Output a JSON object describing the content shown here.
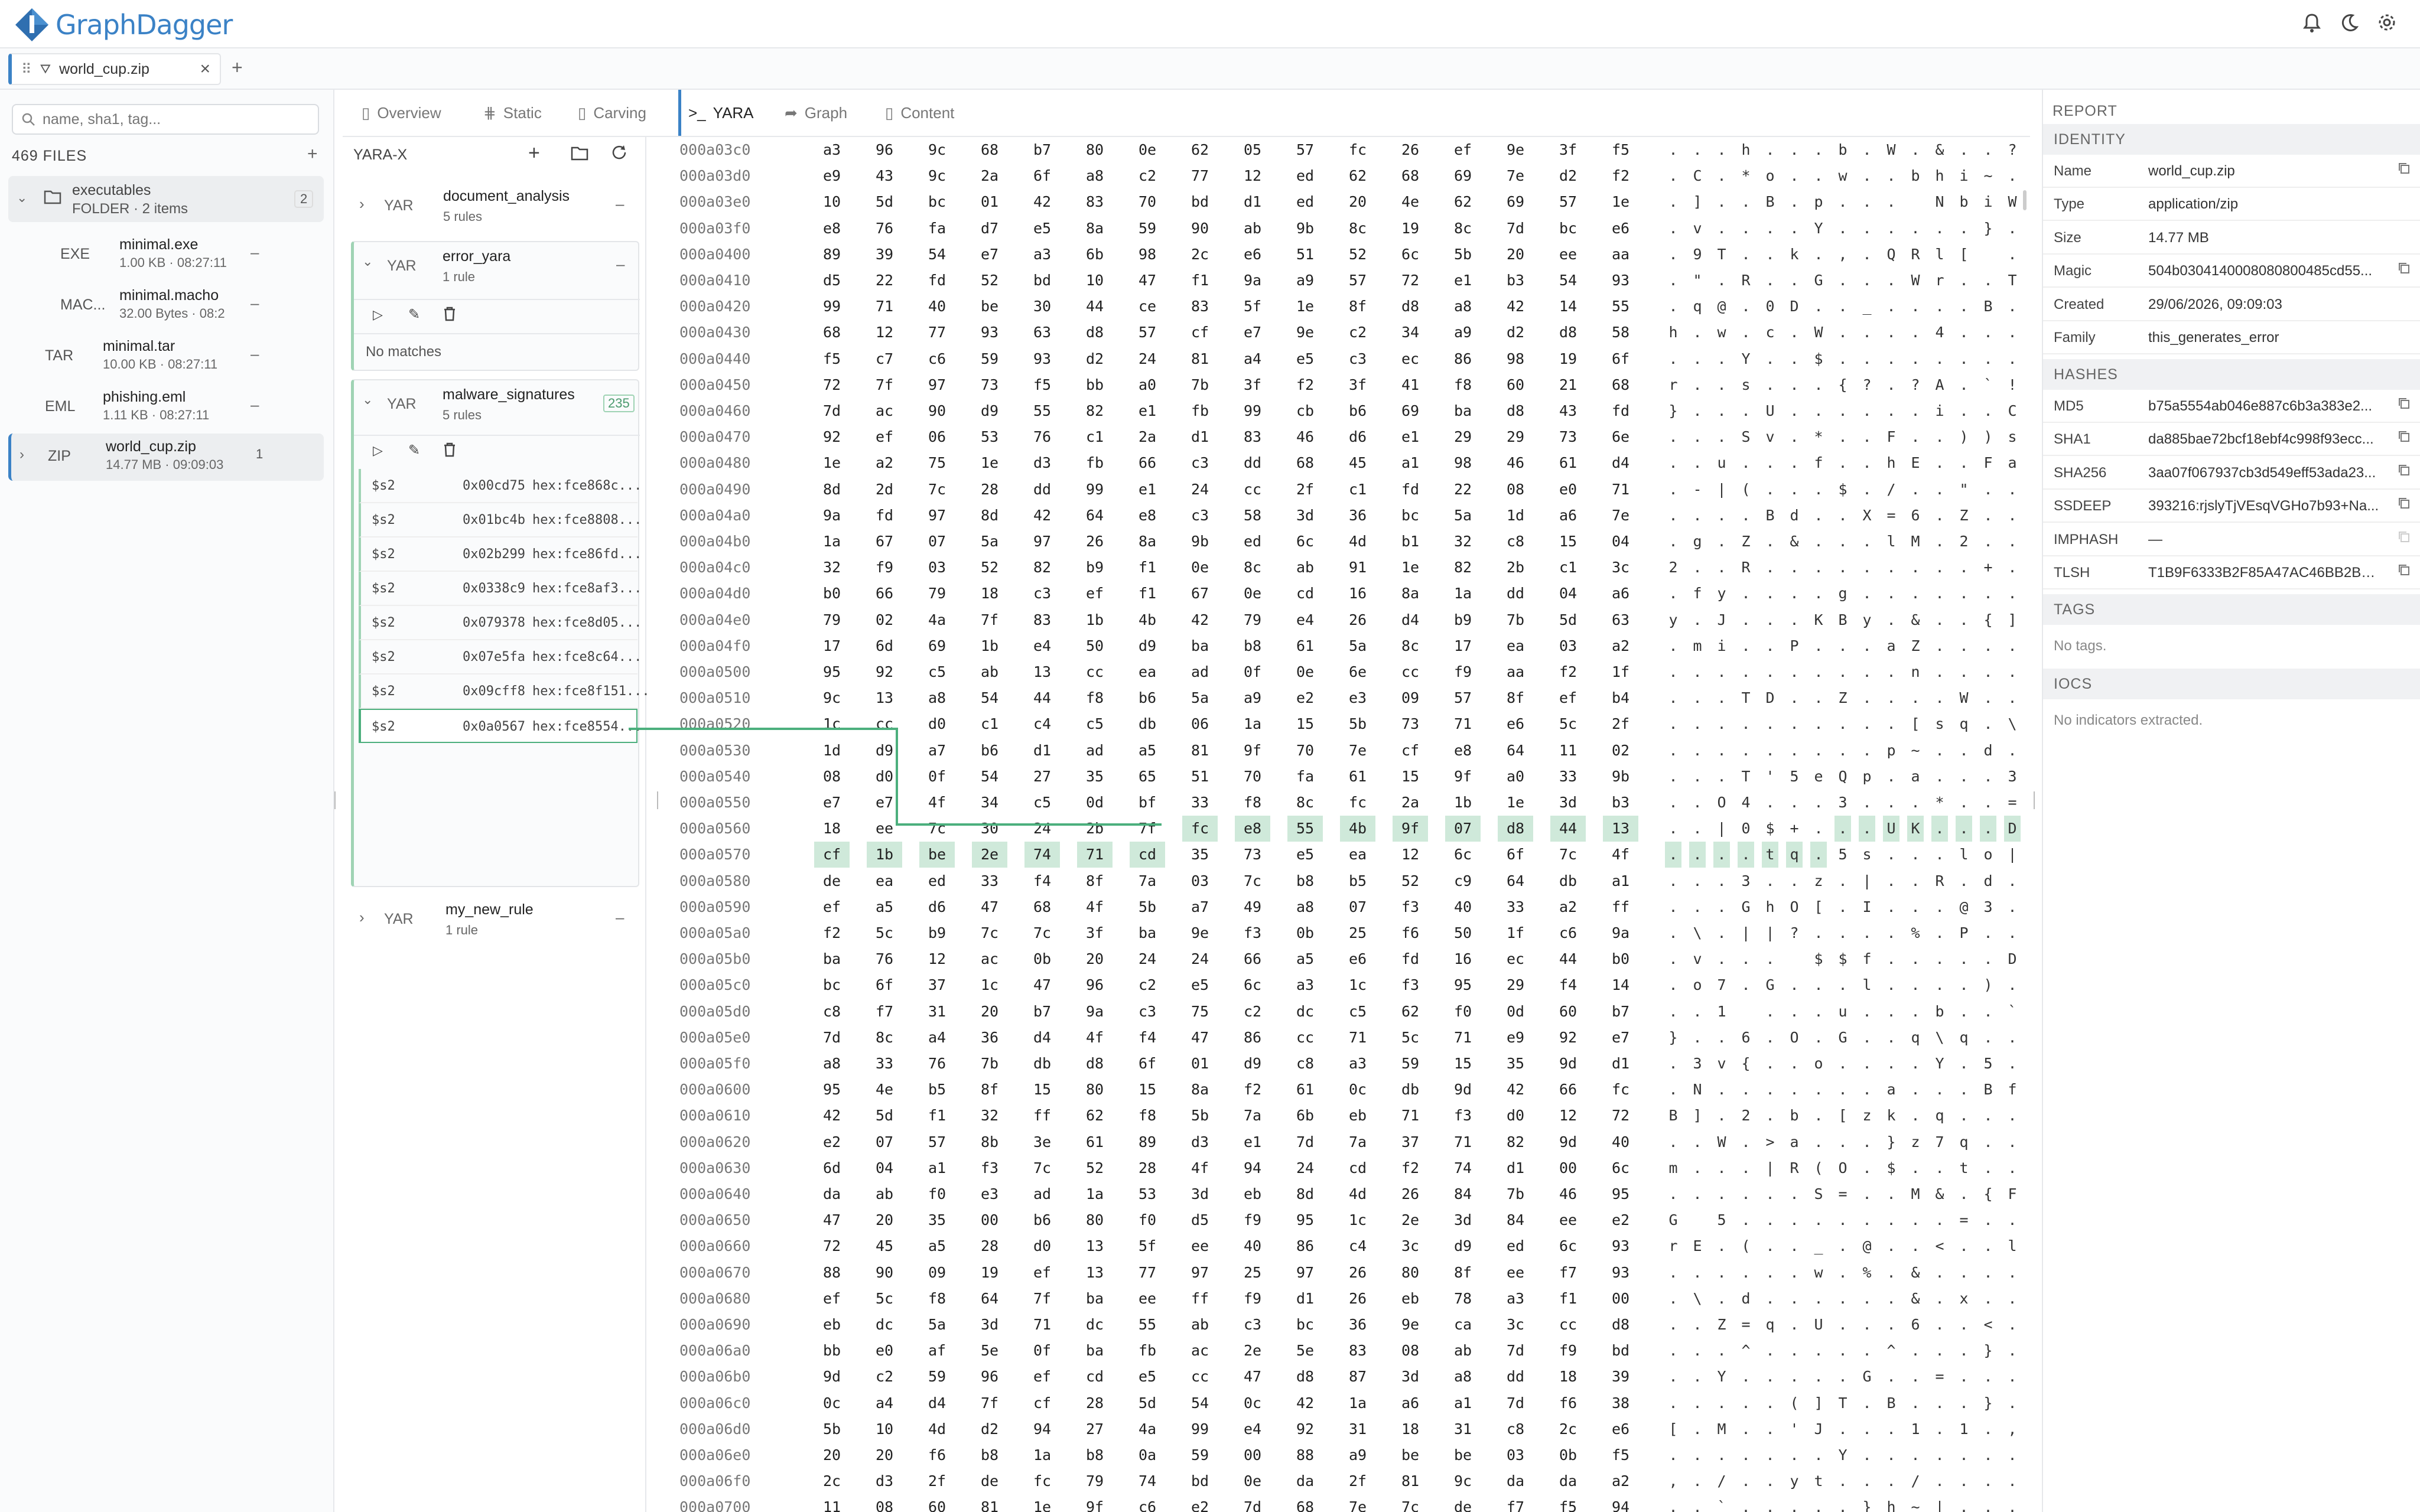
{
  "app": {
    "title": "GraphDagger"
  },
  "tab": {
    "label": "world_cup.zip",
    "close": "×",
    "add": "+"
  },
  "sidebar": {
    "search_placeholder": "name, sha1, tag...",
    "files_count": "469 FILES",
    "add": "+",
    "items": [
      {
        "type": "FOLDER",
        "name": "executables",
        "meta": "FOLDER · 2 items",
        "badge": "2"
      },
      {
        "type": "EXE",
        "name": "minimal.exe",
        "meta": "1.00 KB · 08:27:11"
      },
      {
        "type": "MAC...",
        "name": "minimal.macho",
        "meta": "32.00 Bytes · 08:2"
      },
      {
        "type": "TAR",
        "name": "minimal.tar",
        "meta": "10.00 KB · 08:27:11"
      },
      {
        "type": "EML",
        "name": "phishing.eml",
        "meta": "1.11 KB · 08:27:11"
      },
      {
        "type": "ZIP",
        "name": "world_cup.zip",
        "meta": "14.77 MB · 09:09:03",
        "badge": "1"
      }
    ]
  },
  "main_tabs": [
    "Overview",
    "Static",
    "Carving",
    "YARA",
    "Graph",
    "Content"
  ],
  "yara": {
    "title": "YARA-X",
    "rules": [
      {
        "tag": "YAR",
        "name": "document_analysis",
        "count": "5 rules"
      },
      {
        "tag": "YAR",
        "name": "error_yara",
        "count": "1 rule",
        "no_matches": "No matches"
      },
      {
        "tag": "YAR",
        "name": "malware_signatures",
        "count": "5 rules",
        "badge": "235"
      },
      {
        "tag": "YAR",
        "name": "my_new_rule",
        "count": "1 rule"
      }
    ],
    "matches": [
      {
        "id": "$s2",
        "offset": "0x00cd75",
        "hex": "hex:fce868c..."
      },
      {
        "id": "$s2",
        "offset": "0x01bc4b",
        "hex": "hex:fce8808..."
      },
      {
        "id": "$s2",
        "offset": "0x02b299",
        "hex": "hex:fce86fd..."
      },
      {
        "id": "$s2",
        "offset": "0x0338c9",
        "hex": "hex:fce8af3..."
      },
      {
        "id": "$s2",
        "offset": "0x079378",
        "hex": "hex:fce8d05..."
      },
      {
        "id": "$s2",
        "offset": "0x07e5fa",
        "hex": "hex:fce8c64..."
      },
      {
        "id": "$s2",
        "offset": "0x09cff8",
        "hex": "hex:fce8f151..."
      },
      {
        "id": "$s2",
        "offset": "0x0a0567",
        "hex": "hex:fce8554..."
      }
    ]
  },
  "hex": {
    "rows": [
      [
        "000a03c0",
        "a3 96 9c 68 b7 80 0e 62 05 57 fc 26 ef 9e 3f f5",
        ". . . h . . . b . W . & . . ? ."
      ],
      [
        "000a03d0",
        "e9 43 9c 2a 6f a8 c2 77 12 ed 62 68 69 7e d2 f2",
        ". C . * o . . w . . b h i ~ . ."
      ],
      [
        "000a03e0",
        "10 5d bc 01 42 83 70 bd d1 ed 20 4e 62 69 57 1e",
        ". ] . . B . p . . .   N b i W ."
      ],
      [
        "000a03f0",
        "e8 76 fa d7 e5 8a 59 90 ab 9b 8c 19 8c 7d bc e6",
        ". v . . . . Y . . . . . . } . ."
      ],
      [
        "000a0400",
        "89 39 54 e7 a3 6b 98 2c e6 51 52 6c 5b 20 ee aa",
        ". 9 T . . k . , . Q R l [   . ."
      ],
      [
        "000a0410",
        "d5 22 fd 52 bd 10 47 f1 9a a9 57 72 e1 b3 54 93",
        ". \" . R . . G . . . W r . . T ."
      ],
      [
        "000a0420",
        "99 71 40 be 30 44 ce 83 5f 1e 8f d8 a8 42 14 55",
        ". q @ . 0 D . . _ . . . . B . U"
      ],
      [
        "000a0430",
        "68 12 77 93 63 d8 57 cf e7 9e c2 34 a9 d2 d8 58",
        "h . w . c . W . . . . 4 . . . X"
      ],
      [
        "000a0440",
        "f5 c7 c6 59 93 d2 24 81 a4 e5 c3 ec 86 98 19 6f",
        ". . . Y . . $ . . . . . . . . o"
      ],
      [
        "000a0450",
        "72 7f 97 73 f5 bb a0 7b 3f f2 3f 41 f8 60 21 68",
        "r . . s . . . { ? . ? A . ` ! h"
      ],
      [
        "000a0460",
        "7d ac 90 d9 55 82 e1 fb 99 cb b6 69 ba d8 43 fd",
        "} . . . U . . . . . . i . . C ."
      ],
      [
        "000a0470",
        "92 ef 06 53 76 c1 2a d1 83 46 d6 e1 29 29 73 6e",
        ". . . S v . * . . F . . ) ) s n"
      ],
      [
        "000a0480",
        "1e a2 75 1e d3 fb 66 c3 dd 68 45 a1 98 46 61 d4",
        ". . u . . . f . . h E . . F a ."
      ],
      [
        "000a0490",
        "8d 2d 7c 28 dd 99 e1 24 cc 2f c1 fd 22 08 e0 71",
        ". - | ( . . . $ . / . . \" . . q"
      ],
      [
        "000a04a0",
        "9a fd 97 8d 42 64 e8 c3 58 3d 36 bc 5a 1d a6 7e",
        ". . . . B d . . X = 6 . Z . . ~"
      ],
      [
        "000a04b0",
        "1a 67 07 5a 97 26 8a 9b ed 6c 4d b1 32 c8 15 04",
        ". g . Z . & . . . l M . 2 . . ."
      ],
      [
        "000a04c0",
        "32 f9 03 52 82 b9 f1 0e 8c ab 91 1e 82 2b c1 3c",
        "2 . . R . . . . . . . . . + . <"
      ],
      [
        "000a04d0",
        "b0 66 79 18 c3 ef f1 67 0e cd 16 8a 1a dd 04 a6",
        ". f y . . . . g . . . . . . . ."
      ],
      [
        "000a04e0",
        "79 02 4a 7f 83 1b 4b 42 79 e4 26 d4 b9 7b 5d 63",
        "y . J . . . K B y . & . . { ] c"
      ],
      [
        "000a04f0",
        "17 6d 69 1b e4 50 d9 ba b8 61 5a 8c 17 ea 03 a2",
        ". m i . . P . . . a Z . . . . ."
      ],
      [
        "000a0500",
        "95 92 c5 ab 13 cc ea ad 0f 0e 6e cc f9 aa f2 1f",
        ". . . . . . . . . . n . . . . ."
      ],
      [
        "000a0510",
        "9c 13 a8 54 44 f8 b6 5a a9 e2 e3 09 57 8f ef b4",
        ". . . T D . . Z . . . . W . . ."
      ],
      [
        "000a0520",
        "1c cc d0 c1 c4 c5 db 06 1a 15 5b 73 71 e6 5c 2f",
        ". . . . . . . . . . [ s q . \\ /"
      ],
      [
        "000a0530",
        "1d d9 a7 b6 d1 ad a5 81 9f 70 7e cf e8 64 11 02",
        ". . . . . . . . . p ~ . . d . ."
      ],
      [
        "000a0540",
        "08 d0 0f 54 27 35 65 51 70 fa 61 15 9f a0 33 9b",
        ". . . T ' 5 e Q p . a . . . 3 ."
      ],
      [
        "000a0550",
        "e7 e7 4f 34 c5 0d bf 33 f8 8c fc 2a 1b 1e 3d b3",
        ". . O 4 . . . 3 . . . * . . = ."
      ],
      [
        "000a0560",
        "18 ee 7c 30 24 2b 7f fc e8 55 4b 9f 07 d8 44 13",
        ". . | 0 $ + . . . U K . . . D ."
      ],
      [
        "000a0570",
        "cf 1b be 2e 74 71 cd 35 73 e5 ea 12 6c 6f 7c 4f",
        ". . . . t q . 5 s . . . l o | O"
      ],
      [
        "000a0580",
        "de ea ed 33 f4 8f 7a 03 7c b8 b5 52 c9 64 db a1",
        ". . . 3 . . z . | . . R . d . ."
      ],
      [
        "000a0590",
        "ef a5 d6 47 68 4f 5b a7 49 a8 07 f3 40 33 a2 ff",
        ". . . G h O [ . I . . . @ 3 . ."
      ],
      [
        "000a05a0",
        "f2 5c b9 7c 7c 3f ba 9e f3 0b 25 f6 50 1f c6 9a",
        ". \\ . | | ? . . . . % . P . . ."
      ],
      [
        "000a05b0",
        "ba 76 12 ac 0b 20 24 24 66 a5 e6 fd 16 ec 44 b0",
        ". v . . .   $ $ f . . . . . D ."
      ],
      [
        "000a05c0",
        "bc 6f 37 1c 47 96 c2 e5 6c a3 1c f3 95 29 f4 14",
        ". o 7 . G . . . l . . . . ) . ."
      ],
      [
        "000a05d0",
        "c8 f7 31 20 b7 9a c3 75 c2 dc c5 62 f0 0d 60 b7",
        ". . 1   . . . u . . . b . . ` ."
      ],
      [
        "000a05e0",
        "7d 8c a4 36 d4 4f f4 47 86 cc 71 5c 71 e9 92 e7",
        "} . . 6 . O . G . . q \\ q . . ."
      ],
      [
        "000a05f0",
        "a8 33 76 7b db d8 6f 01 d9 c8 a3 59 15 35 9d d1",
        ". 3 v { . . o . . . . Y . 5 . ."
      ],
      [
        "000a0600",
        "95 4e b5 8f 15 80 15 8a f2 61 0c db 9d 42 66 fc",
        ". N . . . . . . . a . . . B f ."
      ],
      [
        "000a0610",
        "42 5d f1 32 ff 62 f8 5b 7a 6b eb 71 f3 d0 12 72",
        "B ] . 2 . b . [ z k . q . . . r"
      ],
      [
        "000a0620",
        "e2 07 57 8b 3e 61 89 d3 e1 7d 7a 37 71 82 9d 40",
        ". . W . > a . . . } z 7 q . . @"
      ],
      [
        "000a0630",
        "6d 04 a1 f3 7c 52 28 4f 94 24 cd f2 74 d1 00 6c",
        "m . . . | R ( O . $ . . t . . l"
      ],
      [
        "000a0640",
        "da ab f0 e3 ad 1a 53 3d eb 8d 4d 26 84 7b 46 95",
        ". . . . . . S = . . M & . { F ."
      ],
      [
        "000a0650",
        "47 20 35 00 b6 80 f0 d5 f9 95 1c 2e 3d 84 ee e2",
        "G   5 . . . . . . . . . = . . ."
      ],
      [
        "000a0660",
        "72 45 a5 28 d0 13 5f ee 40 86 c4 3c d9 ed 6c 93",
        "r E . ( . . _ . @ . . < . . l ."
      ],
      [
        "000a0670",
        "88 90 09 19 ef 13 77 97 25 97 26 80 8f ee f7 93",
        ". . . . . . w . % . & . . . . ."
      ],
      [
        "000a0680",
        "ef 5c f8 64 7f ba ee ff f9 d1 26 eb 78 a3 f1 00",
        ". \\ . d . . . . . . & . x . . ."
      ],
      [
        "000a0690",
        "eb dc 5a 3d 71 dc 55 ab c3 bc 36 9e ca 3c cc d8",
        ". . Z = q . U . . . 6 . . < . ."
      ],
      [
        "000a06a0",
        "bb e0 af 5e 0f ba fb ac 2e 5e 83 08 ab 7d f9 bd",
        ". . . ^ . . . . . ^ . . . } . ."
      ],
      [
        "000a06b0",
        "9d c2 59 96 ef cd e5 cc 47 d8 87 3d a8 dd 18 39",
        ". . Y . . . . . G . . = . . . 9"
      ],
      [
        "000a06c0",
        "0c a4 d4 7f cf 28 5d 54 0c 42 1a a6 a1 7d f6 38",
        ". . . . . ( ] T . B . . . } . 8"
      ],
      [
        "000a06d0",
        "5b 10 4d d2 94 27 4a 99 e4 92 31 18 31 c8 2c e6",
        "[ . M . . ' J . . . 1 . 1 . , ."
      ],
      [
        "000a06e0",
        "20 20 f6 b8 1a b8 0a 59 00 88 a9 be be 03 0b f5",
        ". . . . . . . Y . . . . . . . ."
      ],
      [
        "000a06f0",
        "2c d3 2f de fc 79 74 bd 0e da 2f 81 9c da da a2",
        ", . / . . y t . . . / . . . . ."
      ],
      [
        "000a0700",
        "11 08 60 81 1e 9f c6 e2 7d 68 7e 7c de f7 f5 94",
        ". . ` . . . . . } h ~ | . . . ."
      ]
    ]
  },
  "report": {
    "title": "REPORT",
    "identity": "IDENTITY",
    "fields": [
      {
        "k": "Name",
        "v": "world_cup.zip",
        "copy": true
      },
      {
        "k": "Type",
        "v": "application/zip"
      },
      {
        "k": "Size",
        "v": "14.77 MB"
      },
      {
        "k": "Magic",
        "v": "504b0304140008080800485cd55...",
        "copy": true
      },
      {
        "k": "Created",
        "v": "29/06/2026, 09:09:03"
      },
      {
        "k": "Family",
        "v": "this_generates_error"
      }
    ],
    "hashes_title": "HASHES",
    "hashes": [
      {
        "k": "MD5",
        "v": "b75a5554ab046e887c6b3a383e2..."
      },
      {
        "k": "SHA1",
        "v": "da885bae72bcf18ebf4c998f93ecc..."
      },
      {
        "k": "SHA256",
        "v": "3aa07f067937cb3d549eff53ada23..."
      },
      {
        "k": "SSDEEP",
        "v": "393216:rjslyTjVEsqVGHo7b93+Na..."
      },
      {
        "k": "IMPHASH",
        "v": "—"
      },
      {
        "k": "TLSH",
        "v": "T1B9F6333B2F85A47AC46BB2BE2..."
      }
    ],
    "tags_title": "TAGS",
    "tags_empty": "No tags.",
    "iocs_title": "IOCS",
    "iocs_empty": "No indicators extracted."
  },
  "colors": {
    "accent": "#3b82c6",
    "highlight": "#cfe9da",
    "match_line": "#4caf7d"
  }
}
